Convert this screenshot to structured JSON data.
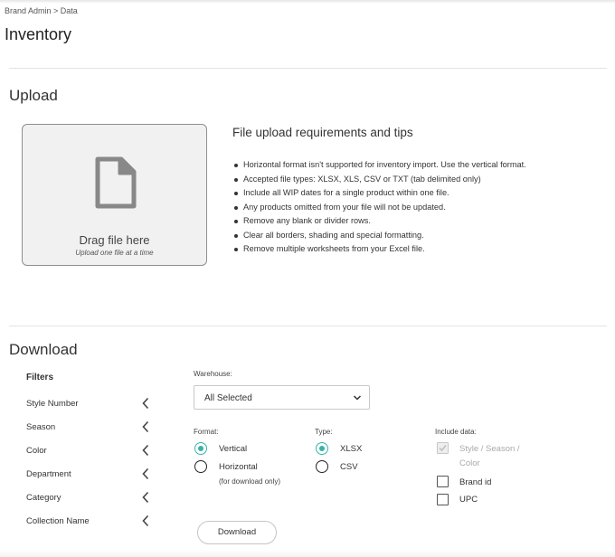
{
  "breadcrumb": "Brand Admin > Data",
  "page_title": "Inventory",
  "upload": {
    "title": "Upload",
    "drop_title": "Drag file here",
    "drop_subtitle": "Upload one file at a time",
    "tips_title": "File upload requirements and tips",
    "tips": [
      "Horizontal format isn't supported for inventory import. Use the vertical format.",
      "Accepted file types: XLSX, XLS, CSV or TXT (tab delimited only)",
      "Include all WIP dates for a single product within one file.",
      "Any products omitted from your file will not be updated.",
      "Remove any blank or divider rows.",
      "Clear all borders, shading and special formatting.",
      "Remove multiple worksheets from your Excel file."
    ]
  },
  "download": {
    "title": "Download",
    "filters_title": "Filters",
    "filters": [
      {
        "label": "Style Number"
      },
      {
        "label": "Season"
      },
      {
        "label": "Color"
      },
      {
        "label": "Department"
      },
      {
        "label": "Category"
      },
      {
        "label": "Collection Name"
      }
    ],
    "warehouse_label": "Warehouse:",
    "warehouse_value": "All Selected",
    "format_label": "Format:",
    "format_options": [
      "Vertical",
      "Horizontal"
    ],
    "format_selected": "Vertical",
    "horizontal_note": "(for download only)",
    "type_label": "Type:",
    "type_options": [
      "XLSX",
      "CSV"
    ],
    "type_selected": "XLSX",
    "include_label": "Include data:",
    "include_options": [
      {
        "label_line1": "Style / Season /",
        "label_line2": "Color",
        "checked": true,
        "disabled": true
      },
      {
        "label": "Brand id",
        "checked": false
      },
      {
        "label": "UPC",
        "checked": false
      }
    ],
    "download_button": "Download"
  },
  "colors": {
    "accent": "#39b3a8",
    "dropzone_bg": "#f1f1f1",
    "divider": "#e3e3e3"
  }
}
